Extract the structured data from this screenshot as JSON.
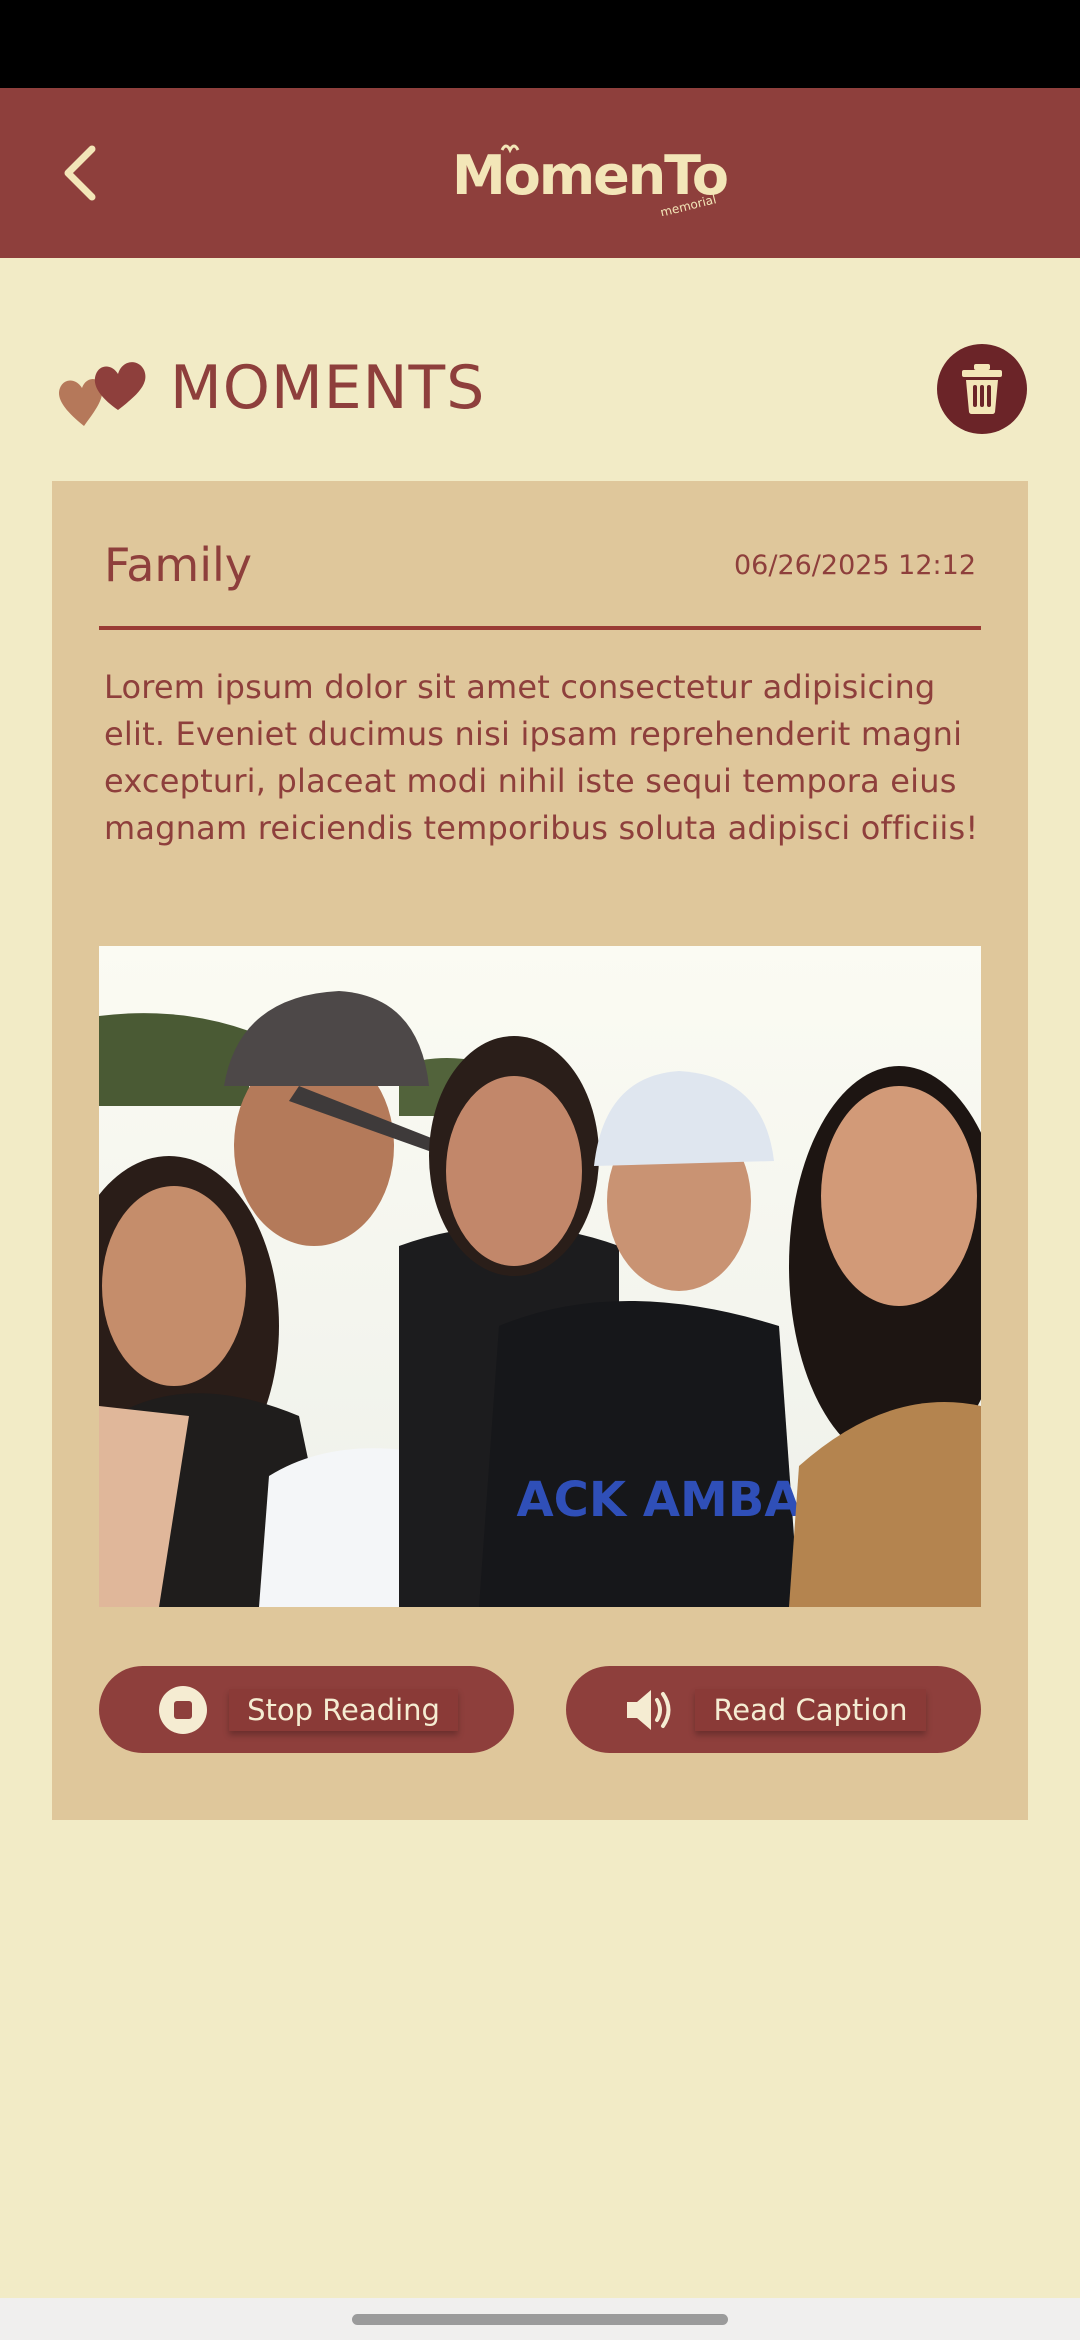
{
  "app": {
    "logo_text": "MomenTo",
    "logo_subtext": "memorial",
    "back_icon": "chevron-left-icon"
  },
  "page": {
    "heading": "MOMENTS",
    "heading_icon": "hearts-icon",
    "delete_icon": "trash-icon"
  },
  "moment": {
    "title": "Family",
    "date": "06/26/2025 12:12",
    "caption": "Lorem ipsum dolor sit amet consectetur adipisicing elit. Eveniet ducimus nisi ipsam reprehenderit magni excepturi, placeat modi nihil iste sequi tempora eius magnam reiciendis temporibus soluta adipisci officiis!",
    "photo_text": "ACK AMBA"
  },
  "actions": {
    "stop_label": "Stop Reading",
    "stop_icon": "stop-circle-icon",
    "read_label": "Read Caption",
    "read_icon": "speaker-icon"
  },
  "colors": {
    "primary": "#8e3f3c",
    "background": "#f2ebc6",
    "card": "#dfc79b",
    "delete_button": "#6b2428",
    "logo": "#f3e6b8"
  }
}
